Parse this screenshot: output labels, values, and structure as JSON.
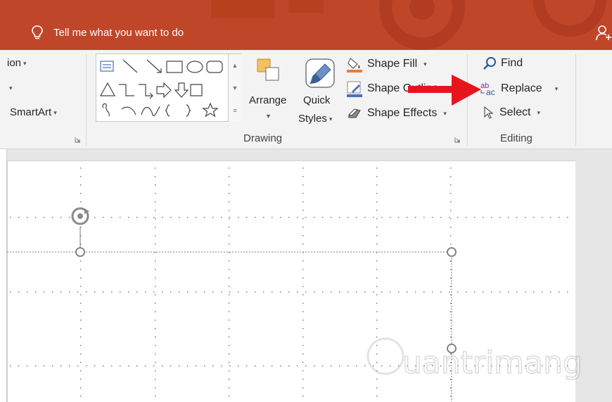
{
  "titlebar": {
    "tell_me": "Tell me what you want to do",
    "bg_color": "#c0462a"
  },
  "ribbon": {
    "left_partial": {
      "row1": "ion",
      "row3": "SmartArt"
    },
    "drawing": {
      "arrange_label": "Arrange",
      "quick_styles_line1": "Quick",
      "quick_styles_line2": "Styles",
      "shape_fill": "Shape Fill",
      "shape_outline": "Shape Outline",
      "shape_effects": "Shape Effects",
      "group_label": "Drawing"
    },
    "editing": {
      "find": "Find",
      "replace": "Replace",
      "select": "Select",
      "group_label": "Editing"
    }
  },
  "annotation": {
    "arrow_color": "#e8141c",
    "points_to": "Replace"
  },
  "watermark": {
    "text": "uantrimang"
  }
}
